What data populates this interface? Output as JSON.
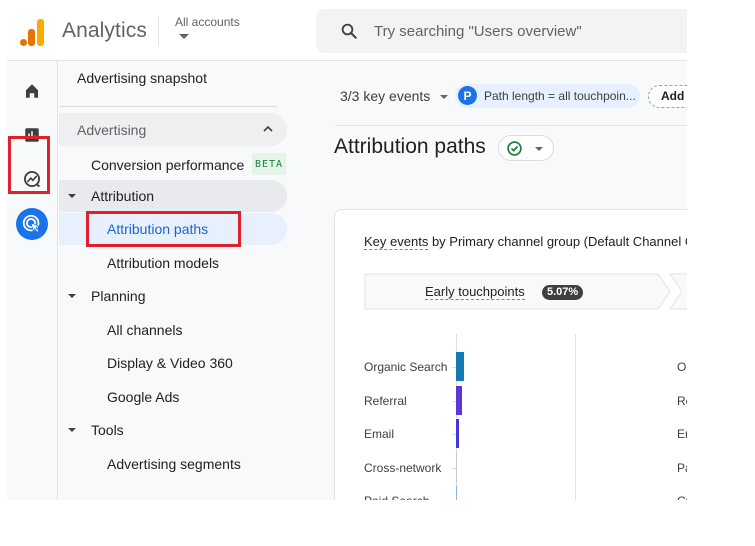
{
  "header": {
    "app_title": "Analytics",
    "account_selector": "All accounts",
    "search_placeholder": "Try searching \"Users overview\""
  },
  "rail": {
    "items": [
      {
        "icon": "home-icon",
        "label": "Home"
      },
      {
        "icon": "reports-icon",
        "label": "Reports"
      },
      {
        "icon": "explore-icon",
        "label": "Explore"
      },
      {
        "icon": "advertising-icon",
        "label": "Advertising",
        "active": true
      }
    ]
  },
  "sidenav": {
    "snapshot": "Advertising snapshot",
    "section": "Advertising",
    "items": [
      {
        "label": "Conversion performance",
        "badge": "BETA"
      },
      {
        "label": "Attribution",
        "group": true,
        "expanded": true
      },
      {
        "label": "Attribution paths",
        "selected": true
      },
      {
        "label": "Attribution models"
      },
      {
        "label": "Planning",
        "group": true,
        "expanded": true
      },
      {
        "label": "All channels"
      },
      {
        "label": "Display & Video 360"
      },
      {
        "label": "Google Ads"
      },
      {
        "label": "Tools",
        "group": true,
        "expanded": true
      },
      {
        "label": "Advertising segments"
      }
    ]
  },
  "main": {
    "key_events_selector": "3/3 key events",
    "filter_chip": {
      "letter": "P",
      "text": "Path length = all touchpoin..."
    },
    "add_filter": "Add filter",
    "page_title": "Attribution paths",
    "card": {
      "title_link": "Key events",
      "title_rest": " by Primary channel group (Default Channel Group)",
      "stage_label": "Early touchpoints",
      "stage_percent": "5.07%"
    }
  },
  "chart_data": {
    "type": "bar",
    "title": "Key events by Primary channel group (Default Channel Group)",
    "stage": "Early touchpoints",
    "stage_share": "5.07%",
    "categories": [
      "Organic Search",
      "Referral",
      "Email",
      "Cross-network",
      "Paid Search"
    ],
    "values": [
      8,
      6,
      3,
      0.5,
      0.5
    ],
    "bar_colors": [
      "#1479b5",
      "#5c35d4",
      "#4338d8",
      "#c8c8c8",
      "#8ab4d8"
    ],
    "xlabel": "",
    "ylabel": "",
    "next_column_labels_truncated": [
      "Or",
      "Re",
      "Em",
      "Pa",
      "Cr"
    ]
  },
  "colors": {
    "accent": "#1a73e8",
    "selected_text": "#1967d2",
    "beta_bg": "#e6f4ea",
    "beta_text": "#188038",
    "status_ok": "#188038",
    "highlight_box": "#e0202a"
  }
}
